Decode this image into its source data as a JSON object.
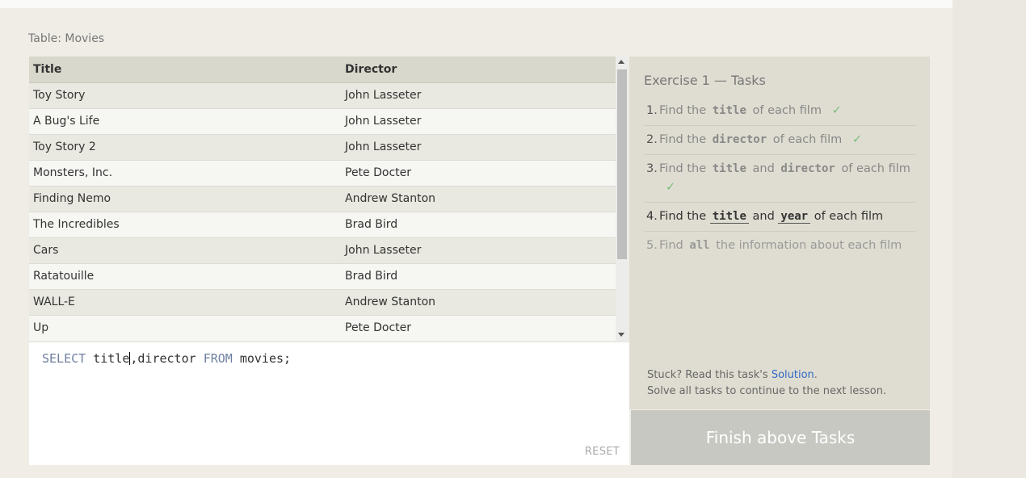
{
  "table": {
    "caption": "Table: Movies",
    "columns": [
      "Title",
      "Director"
    ],
    "rows": [
      [
        "Toy Story",
        "John Lasseter"
      ],
      [
        "A Bug's Life",
        "John Lasseter"
      ],
      [
        "Toy Story 2",
        "John Lasseter"
      ],
      [
        "Monsters, Inc.",
        "Pete Docter"
      ],
      [
        "Finding Nemo",
        "Andrew Stanton"
      ],
      [
        "The Incredibles",
        "Brad Bird"
      ],
      [
        "Cars",
        "John Lasseter"
      ],
      [
        "Ratatouille",
        "Brad Bird"
      ],
      [
        "WALL-E",
        "Andrew Stanton"
      ],
      [
        "Up",
        "Pete Docter"
      ]
    ]
  },
  "editor": {
    "kw_select": "SELECT",
    "code_before_cursor": "title",
    "code_after_cursor": ",director",
    "kw_from": "FROM",
    "code_tail": "movies;",
    "reset_label": "RESET"
  },
  "tasks": {
    "heading": "Exercise 1 — Tasks",
    "items": [
      {
        "num": "1.",
        "parts": [
          "Find the",
          "title",
          "of each film"
        ],
        "check": "✓"
      },
      {
        "num": "2.",
        "parts": [
          "Find the",
          "director",
          "of each film"
        ],
        "check": "✓"
      },
      {
        "num": "3.",
        "parts": [
          "Find the",
          "title",
          "and",
          "director",
          "of each film"
        ],
        "check": "✓"
      },
      {
        "num": "4.",
        "parts": [
          "Find the",
          "title",
          "and",
          "year",
          "of each film"
        ]
      },
      {
        "num": "5.",
        "parts": [
          "Find",
          "all",
          "the information about each film"
        ]
      }
    ],
    "help_prefix": "Stuck? Read this task's",
    "solution_label": "Solution",
    "help_suffix": ".",
    "help_line2": "Solve all tasks to continue to the next lesson."
  },
  "finish_label": "Finish above Tasks",
  "colors": {
    "link": "#3368c8",
    "check": "#7bbe7b",
    "keyword": "#6d7fa0",
    "finish_disabled": "#c8c8c3"
  }
}
